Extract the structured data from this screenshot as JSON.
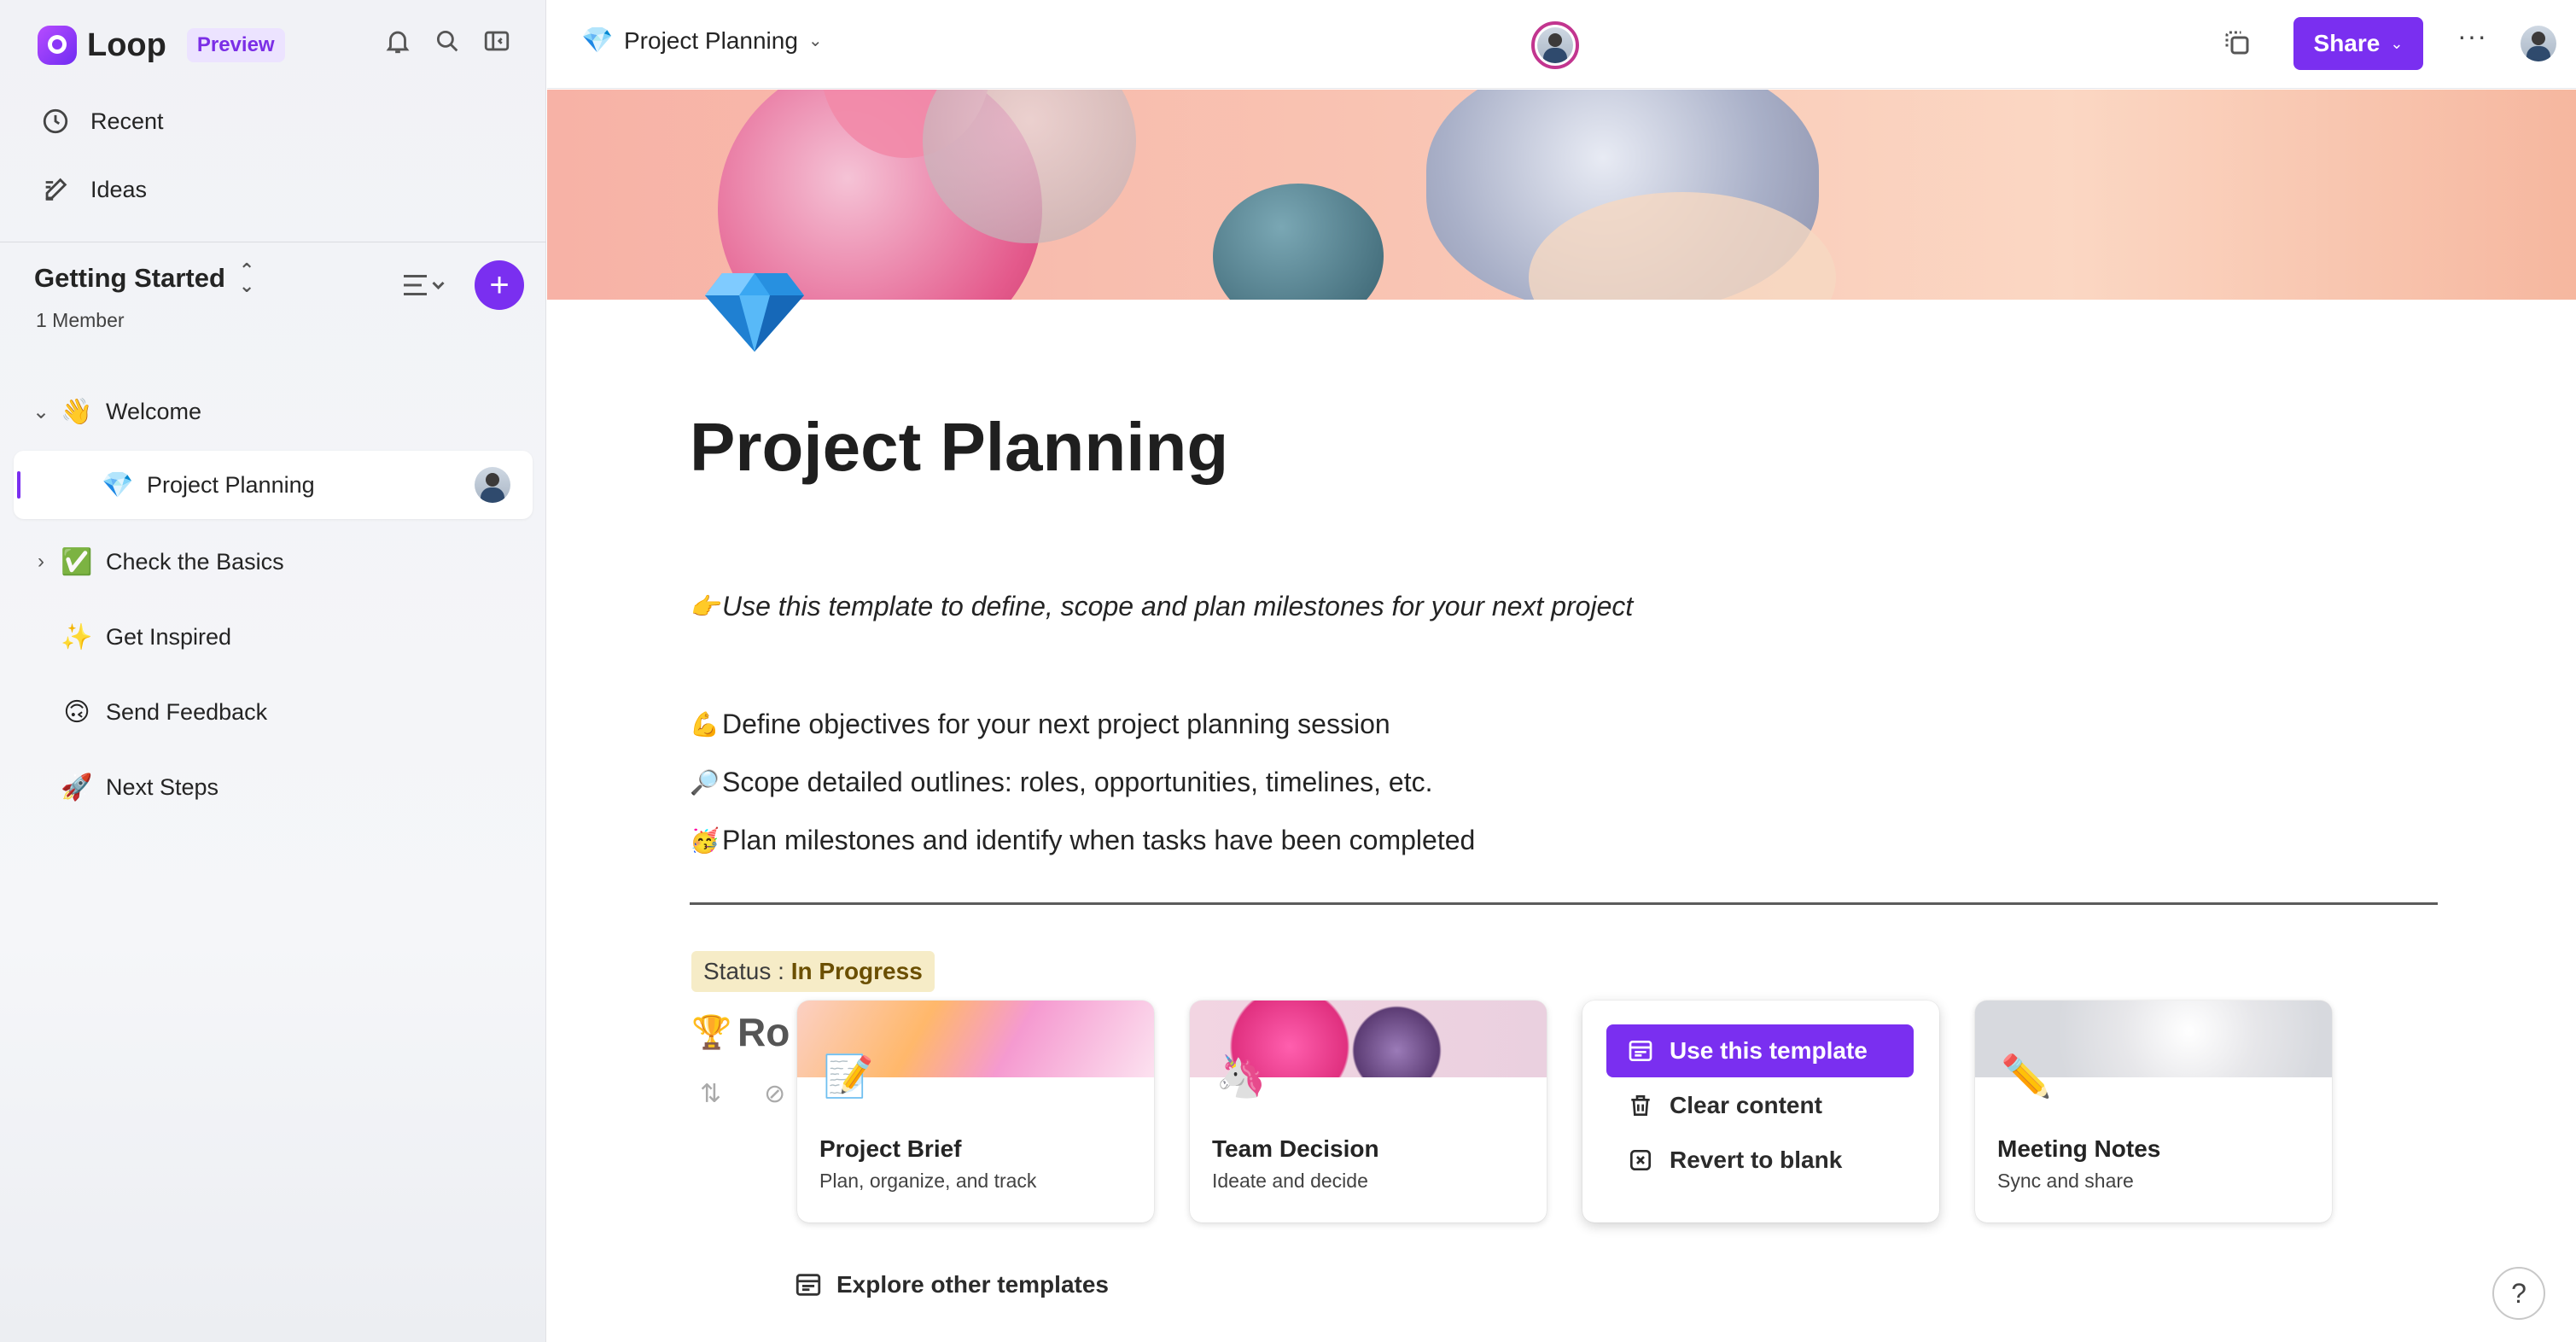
{
  "app": {
    "name": "Loop",
    "badge": "Preview",
    "accent_color": "#7a2ff0",
    "top_icons": [
      "bell-icon",
      "search-icon",
      "sidebar-toggle-icon"
    ]
  },
  "sidebar": {
    "nav": [
      {
        "label": "Recent",
        "icon": "clock-icon"
      },
      {
        "label": "Ideas",
        "icon": "pencil-note-icon"
      }
    ],
    "workspace": {
      "title": "Getting Started",
      "members": "1 Member",
      "add_label": "+"
    },
    "pages": [
      {
        "label": "Welcome",
        "emoji": "👋",
        "chevron": "⌄"
      },
      {
        "label": "Project Planning",
        "emoji": "💎",
        "active": true
      },
      {
        "label": "Check the Basics",
        "emoji": "✅",
        "chevron": "›"
      },
      {
        "label": "Get Inspired",
        "emoji": "✨"
      },
      {
        "label": "Send Feedback",
        "emoji": "🙃"
      },
      {
        "label": "Next Steps",
        "emoji": "🚀"
      }
    ]
  },
  "topbar": {
    "page_emoji": "💎",
    "page_title": "Project Planning",
    "share_label": "Share",
    "more_label": "···"
  },
  "page": {
    "icon_emoji": "💎",
    "title": "Project Planning",
    "intro": {
      "emoji": "👉",
      "text": "Use this template to define, scope and plan milestones for your next project"
    },
    "bullets": [
      {
        "emoji": "💪",
        "text": "Define objectives for your next project planning session"
      },
      {
        "emoji": "🔎",
        "text": "Scope detailed outlines: roles, opportunities, timelines, etc."
      },
      {
        "emoji": "🥳",
        "text": "Plan milestones and identify when tasks have been completed"
      }
    ],
    "status": {
      "label": "Status :",
      "value": "In Progress",
      "color": "#f6ecc7"
    },
    "peek_heading": {
      "emoji": "🏆",
      "text": "Ro"
    }
  },
  "templates": {
    "cards": [
      {
        "title": "Project Brief",
        "subtitle": "Plan, organize, and track",
        "emoji": "📝"
      },
      {
        "title": "Team Decision",
        "subtitle": "Ideate and decide",
        "emoji": "🦄"
      },
      {
        "title": "Meeting Notes",
        "subtitle": "Sync and share",
        "emoji": "✏️"
      }
    ],
    "menu": {
      "use": "Use this template",
      "clear": "Clear content",
      "revert": "Revert to blank"
    },
    "explore_label": "Explore other templates"
  },
  "help": {
    "label": "?"
  }
}
